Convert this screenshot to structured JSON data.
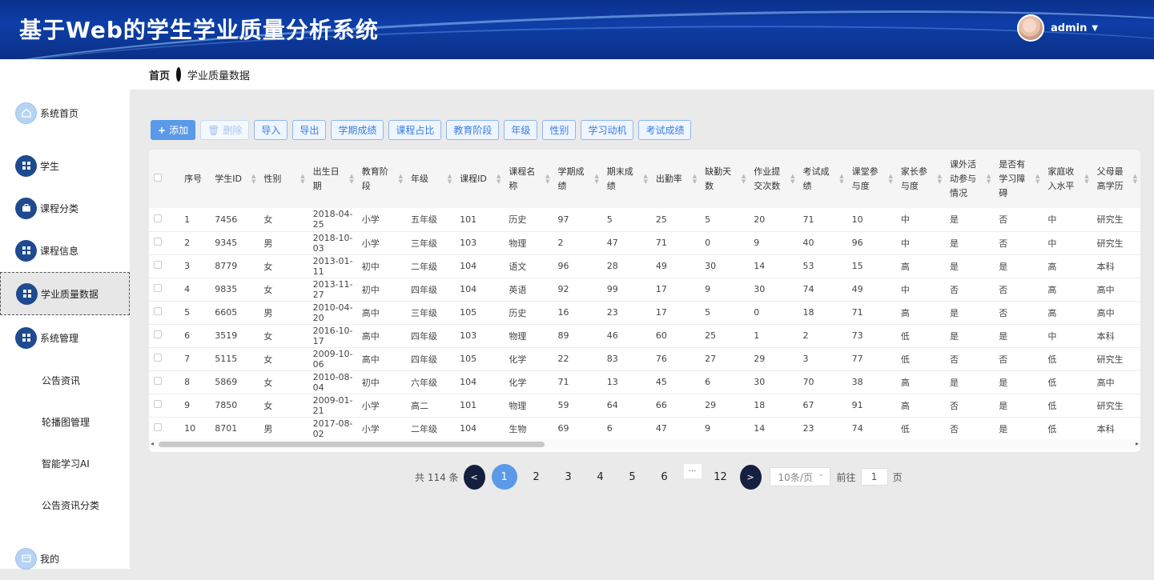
{
  "app": {
    "title": "基于Web的学生学业质量分析系统",
    "user": "admin"
  },
  "breadcrumb": {
    "home": "首页",
    "current": "学业质量数据"
  },
  "sidebar": {
    "items": [
      {
        "label": "系统首页",
        "icon": "home-icon"
      },
      {
        "label": "学生",
        "icon": "grid-icon"
      },
      {
        "label": "课程分类",
        "icon": "briefcase-icon"
      },
      {
        "label": "课程信息",
        "icon": "grid-icon"
      },
      {
        "label": "学业质量数据",
        "icon": "grid-icon"
      },
      {
        "label": "系统管理",
        "icon": "grid-icon"
      }
    ],
    "subitems": [
      "公告资讯",
      "轮播图管理",
      "智能学习AI",
      "公告资讯分类"
    ],
    "bottom": {
      "label": "我的",
      "icon": "card-icon"
    }
  },
  "toolbar": {
    "add": "添加",
    "delete": "删除",
    "import": "导入",
    "export": "导出",
    "term_score": "学期成绩",
    "course_ratio": "课程占比",
    "edu_stage": "教育阶段",
    "grade": "年级",
    "gender": "性别",
    "motivation": "学习动机",
    "exam_score": "考试成绩"
  },
  "table": {
    "headers": [
      "序号",
      "学生ID",
      "性别",
      "出生日期",
      "教育阶段",
      "年级",
      "课程ID",
      "课程名称",
      "学期成绩",
      "期末成绩",
      "出勤率",
      "缺勤天数",
      "作业提交次数",
      "考试成绩",
      "课堂参与度",
      "家长参与度",
      "课外活动参与情况",
      "是否有学习障碍",
      "家庭收入水平",
      "父母最高学历"
    ],
    "rows": [
      [
        "1",
        "7456",
        "女",
        "2018-04-25",
        "小学",
        "五年级",
        "101",
        "历史",
        "97",
        "5",
        "25",
        "5",
        "20",
        "71",
        "10",
        "中",
        "是",
        "否",
        "中",
        "研究生"
      ],
      [
        "2",
        "9345",
        "男",
        "2018-10-03",
        "小学",
        "三年级",
        "103",
        "物理",
        "2",
        "47",
        "71",
        "0",
        "9",
        "40",
        "96",
        "中",
        "是",
        "否",
        "中",
        "研究生"
      ],
      [
        "3",
        "8779",
        "女",
        "2013-01-11",
        "初中",
        "二年级",
        "104",
        "语文",
        "96",
        "28",
        "49",
        "30",
        "14",
        "53",
        "15",
        "高",
        "是",
        "是",
        "高",
        "本科"
      ],
      [
        "4",
        "9835",
        "女",
        "2013-11-27",
        "初中",
        "四年级",
        "104",
        "英语",
        "92",
        "99",
        "17",
        "9",
        "30",
        "74",
        "49",
        "中",
        "否",
        "否",
        "高",
        "高中"
      ],
      [
        "5",
        "6605",
        "男",
        "2010-04-20",
        "高中",
        "三年级",
        "105",
        "历史",
        "16",
        "23",
        "17",
        "5",
        "0",
        "18",
        "71",
        "高",
        "是",
        "否",
        "高",
        "高中"
      ],
      [
        "6",
        "3519",
        "女",
        "2016-10-17",
        "高中",
        "四年级",
        "103",
        "物理",
        "89",
        "46",
        "60",
        "25",
        "1",
        "2",
        "73",
        "低",
        "是",
        "是",
        "中",
        "本科"
      ],
      [
        "7",
        "5115",
        "女",
        "2009-10-06",
        "高中",
        "四年级",
        "105",
        "化学",
        "22",
        "83",
        "76",
        "27",
        "29",
        "3",
        "77",
        "低",
        "否",
        "否",
        "低",
        "研究生"
      ],
      [
        "8",
        "5869",
        "女",
        "2010-08-04",
        "初中",
        "六年级",
        "104",
        "化学",
        "71",
        "13",
        "45",
        "6",
        "30",
        "70",
        "38",
        "高",
        "是",
        "是",
        "低",
        "高中"
      ],
      [
        "9",
        "7850",
        "女",
        "2009-01-21",
        "小学",
        "高二",
        "101",
        "物理",
        "59",
        "64",
        "66",
        "29",
        "18",
        "67",
        "91",
        "高",
        "否",
        "是",
        "低",
        "研究生"
      ],
      [
        "10",
        "8701",
        "男",
        "2017-08-02",
        "小学",
        "二年级",
        "104",
        "生物",
        "69",
        "6",
        "47",
        "9",
        "14",
        "23",
        "74",
        "低",
        "否",
        "是",
        "低",
        "本科"
      ]
    ]
  },
  "pager": {
    "total": "共 114 条",
    "prev": "<",
    "next": ">",
    "pages": [
      "1",
      "2",
      "3",
      "4",
      "5",
      "6"
    ],
    "dots": "···",
    "last": "12",
    "page_size": "10条/页",
    "goto": "前往",
    "goto_value": "1",
    "page_unit": "页"
  }
}
